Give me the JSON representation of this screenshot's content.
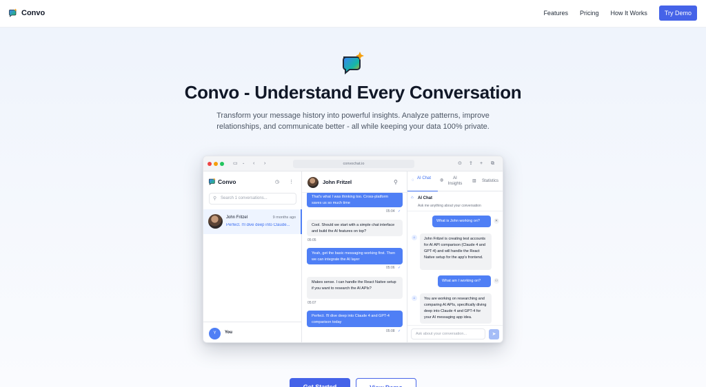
{
  "nav": {
    "brand": "Convo",
    "links": [
      "Features",
      "Pricing",
      "How It Works"
    ],
    "cta": "Try Demo"
  },
  "hero": {
    "title": "Convo - Understand Every Conversation",
    "subtitle": "Transform your message history into powerful insights. Analyze patterns, improve relationships, and communicate better - all while keeping your data 100% private."
  },
  "browser": {
    "url": "convochat.io",
    "sidebar": {
      "title": "Convo",
      "search_placeholder": "Search 1 conversations...",
      "conversation": {
        "name": "John Fritzel",
        "time": "9 months ago",
        "preview": "Perfect. I'll dive deep into Claude..."
      },
      "user_initial": "Y",
      "user_label": "You"
    },
    "chat": {
      "contact": "John Fritzel",
      "messages": [
        {
          "from": "me",
          "text": "That's what I was thinking too. Cross-platform saves us so much time",
          "time": "05:04"
        },
        {
          "from": "them",
          "text": "Cool. Should we start with a simple chat interface and build the AI features on top?",
          "time": "05:05"
        },
        {
          "from": "me",
          "text": "Yeah, get the basic messaging working first. Then we can integrate the AI layer",
          "time": "05:06"
        },
        {
          "from": "them",
          "text": "Makes sense. I can handle the React Native setup if you want to research the AI APIs?",
          "time": "05:07"
        },
        {
          "from": "me",
          "text": "Perfect. I'll dive deep into Claude 4 and GPT-4 comparison today",
          "time": "05:08"
        }
      ]
    },
    "panel": {
      "tabs": [
        "AI Chat",
        "AI Insights",
        "Statistics"
      ],
      "active_tab": "AI Chat",
      "header": "AI Chat",
      "subheader": "Ask me anything about your conversation",
      "messages": [
        {
          "role": "user",
          "text": "What is John working on?"
        },
        {
          "role": "ai",
          "text": "John Fritzel is creating test accounts for AI API comparison (Claude 4 and GPT-4) and will handle the React Native setup for the app's frontend."
        },
        {
          "role": "user",
          "text": "What am I working on?"
        },
        {
          "role": "ai",
          "text": "You are working on researching and comparing AI APIs, specifically diving deep into Claude 4 and GPT-4 for your AI messaging app idea."
        }
      ],
      "input_placeholder": "Ask about your conversation..."
    }
  },
  "cta": {
    "primary": "Get Started",
    "secondary": "View Demo"
  },
  "colors": {
    "accent": "#4563e8",
    "bubble_blue": "#4f7ff5",
    "text_dark": "#111827"
  }
}
